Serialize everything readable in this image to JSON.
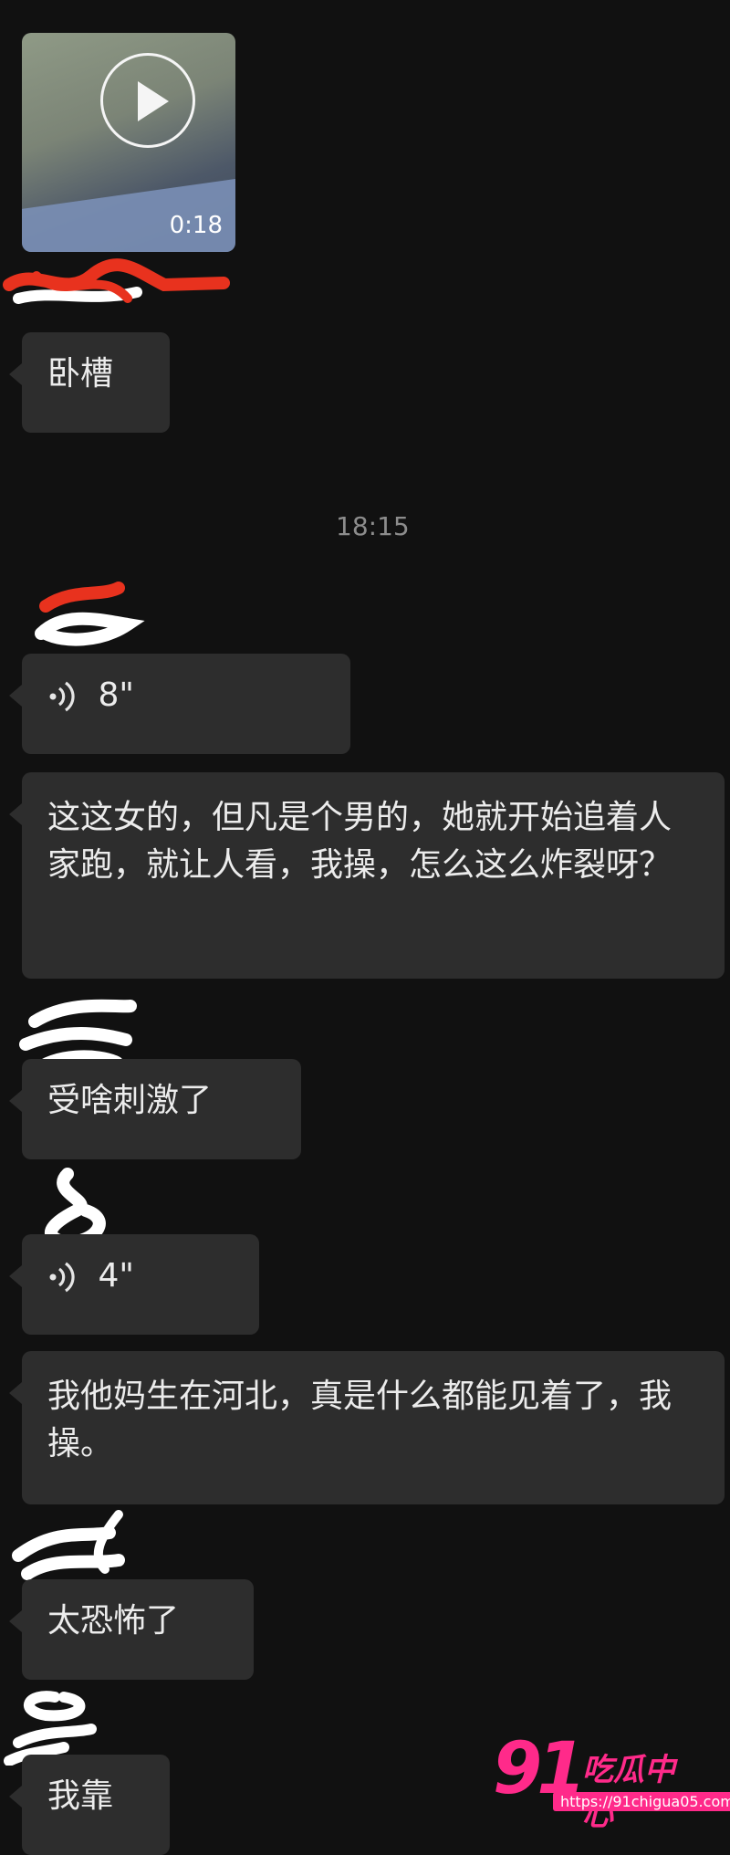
{
  "video": {
    "duration": "0:18"
  },
  "timestamp": "18:15",
  "messages": [
    {
      "type": "text",
      "text": "卧槽"
    },
    {
      "type": "voice",
      "duration": "8\""
    },
    {
      "type": "text",
      "text": "这这女的，但凡是个男的，她就开始追着人家跑，就让人看，我操，怎么这么炸裂呀？"
    },
    {
      "type": "text",
      "text": "受啥刺激了"
    },
    {
      "type": "voice",
      "duration": "4\""
    },
    {
      "type": "text",
      "text": "我他妈生在河北，真是什么都能见着了，我操。"
    },
    {
      "type": "text",
      "text": "太恐怖了"
    },
    {
      "type": "text",
      "text": "我靠"
    }
  ],
  "watermark": {
    "number": "91",
    "name": "吃瓜中心",
    "url": "https://91chigua05.com"
  },
  "colors": {
    "background": "#111111",
    "bubble": "#2d2d2d",
    "watermark": "#ff2a8a"
  }
}
